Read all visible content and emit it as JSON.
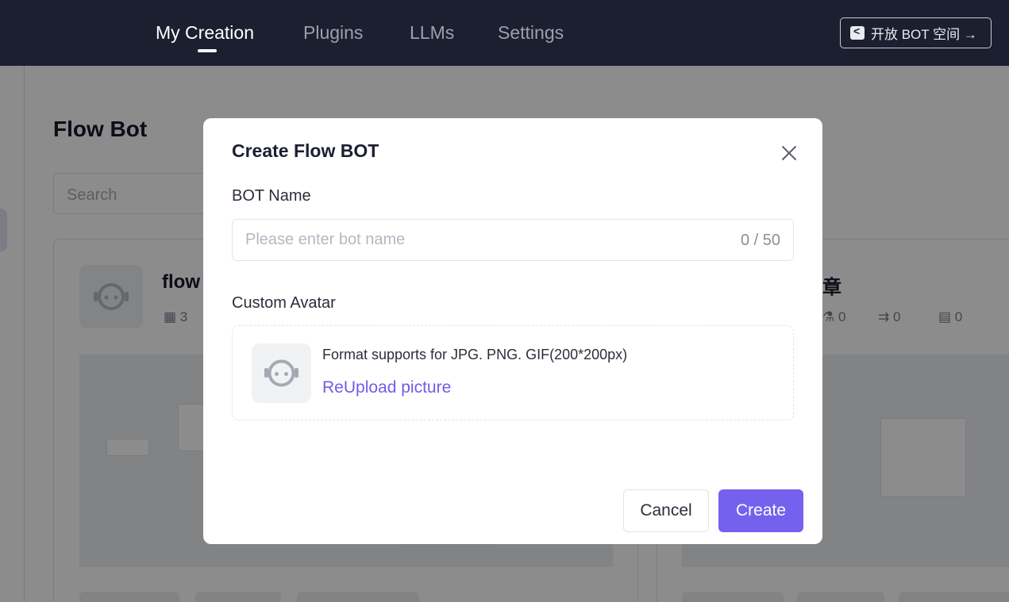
{
  "nav": {
    "tabs": [
      {
        "label": "My Creation",
        "active": true
      },
      {
        "label": "Plugins",
        "active": false
      },
      {
        "label": "LLMs",
        "active": false
      },
      {
        "label": "Settings",
        "active": false
      }
    ],
    "space_button": "开放 BOT 空间 →"
  },
  "background": {
    "page_title": "Flow Bot",
    "search_placeholder": "Search",
    "cards": [
      {
        "title": "flow",
        "stats": [
          "3"
        ]
      },
      {
        "title": "章",
        "stats": [
          "0",
          "0",
          "0"
        ]
      }
    ]
  },
  "modal": {
    "title": "Create Flow BOT",
    "bot_name_label": "BOT Name",
    "bot_name_value": "",
    "bot_name_placeholder": "Please enter bot name",
    "bot_name_count": "0 / 50",
    "avatar_label": "Custom Avatar",
    "avatar_format": "Format supports for JPG. PNG. GIF(200*200px)",
    "reupload_label": "ReUpload picture",
    "cancel_label": "Cancel",
    "create_label": "Create"
  },
  "colors": {
    "topbar": "#1b1f30",
    "accent": "#7561ee",
    "link": "#6e5ee8"
  }
}
